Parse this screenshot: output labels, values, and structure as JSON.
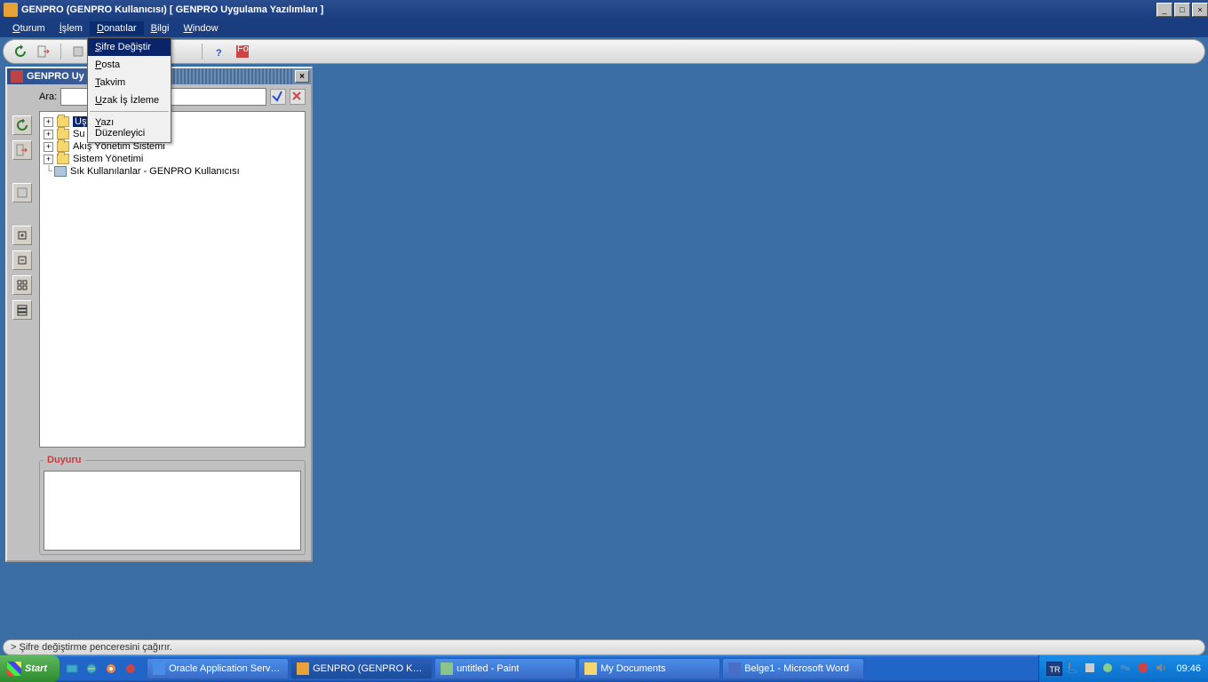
{
  "titlebar": {
    "text": "GENPRO (GENPRO Kullanıcısı) [ GENPRO Uygulama Yazılımları ]"
  },
  "menubar": {
    "items": [
      {
        "label": "Oturum",
        "ul": "O"
      },
      {
        "label": "İşlem",
        "ul": "İ"
      },
      {
        "label": "Donatılar",
        "ul": "D",
        "active": true
      },
      {
        "label": "Bilgi",
        "ul": "B"
      },
      {
        "label": "Window",
        "ul": "W"
      }
    ]
  },
  "dropdown": {
    "items": [
      {
        "label": "Şifre Değiştir",
        "ul": "Ş",
        "selected": true
      },
      {
        "label": "Posta",
        "ul": "P"
      },
      {
        "label": "Takvim",
        "ul": "T"
      },
      {
        "label": "Uzak İş İzleme",
        "ul": "U"
      },
      {
        "sep": true
      },
      {
        "label": "Yazı Düzenleyici",
        "ul": "Y"
      }
    ]
  },
  "inner": {
    "title": "GENPRO Uy",
    "search_label": "Ara:",
    "tree": [
      {
        "toggle": "+",
        "icon": "folder",
        "label": "Uşak Tekstil Sistemi",
        "selected": true,
        "indent": 0,
        "partial_visible": "istemi"
      },
      {
        "toggle": "+",
        "icon": "folder",
        "label": "Su",
        "indent": 0
      },
      {
        "toggle": "+",
        "icon": "folder",
        "label": "Akış Yönetim Sistemi",
        "indent": 0
      },
      {
        "toggle": "+",
        "icon": "folder",
        "label": "Sistem Yönetimi",
        "indent": 0
      },
      {
        "toggle": "",
        "icon": "fav",
        "label": "Sık Kullanılanlar - GENPRO Kullanıcısı",
        "indent": 0
      }
    ],
    "duyuru_label": "Duyuru"
  },
  "statusbar": {
    "text": "> Şifre değiştirme penceresini çağırır."
  },
  "taskbar": {
    "start": "Start",
    "items": [
      {
        "label": "Oracle Application Serve...",
        "icon_color": "#4a8de8"
      },
      {
        "label": "GENPRO (GENPRO Kull...",
        "icon_color": "#e8a23a",
        "active": true
      },
      {
        "label": "untitled - Paint",
        "icon_color": "#8bc48b"
      },
      {
        "label": "My Documents",
        "icon_color": "#f5d76e"
      },
      {
        "label": "Belge1 - Microsoft Word",
        "icon_color": "#4a6dc8"
      }
    ],
    "lang": "TR",
    "clock": "09:46"
  }
}
